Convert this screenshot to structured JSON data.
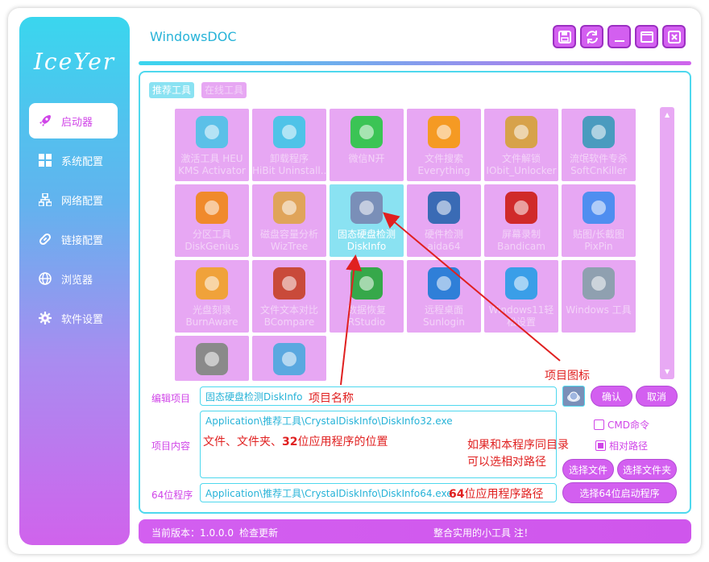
{
  "sidebar": {
    "logo": "IceYer",
    "items": [
      {
        "label": "启动器",
        "icon": "rocket-icon"
      },
      {
        "label": "系统配置",
        "icon": "windows-icon"
      },
      {
        "label": "网络配置",
        "icon": "network-icon"
      },
      {
        "label": "链接配置",
        "icon": "link-icon"
      },
      {
        "label": "浏览器",
        "icon": "globe-icon"
      },
      {
        "label": "软件设置",
        "icon": "gear-icon"
      }
    ]
  },
  "header": {
    "title": "WindowsDOC"
  },
  "window_buttons": [
    "save-icon",
    "refresh-icon",
    "minimize-icon",
    "maximize-icon",
    "close-icon"
  ],
  "tabs": [
    "推荐工具",
    "在线工具"
  ],
  "tiles": [
    {
      "line1": "激活工具 HEU",
      "line2": "KMS Activator",
      "icon": "cube-icon",
      "color": "#5bc0e8"
    },
    {
      "line1": "卸载程序",
      "line2": "HiBit Uninstall...",
      "icon": "trash-icon",
      "color": "#4fc3e8"
    },
    {
      "line1": "微信N开",
      "line2": "",
      "icon": "wechat-icon",
      "color": "#3bc455"
    },
    {
      "line1": "文件搜索",
      "line2": "Everything",
      "icon": "magnifier-icon",
      "color": "#f59a23"
    },
    {
      "line1": "文件解锁",
      "line2": "IObit_Unlocker",
      "icon": "padlock-icon",
      "color": "#d7a24a"
    },
    {
      "line1": "流氓软件专杀",
      "line2": "SoftCnKiller",
      "icon": "x-circle-icon",
      "color": "#4a9bbf"
    },
    {
      "line1": "分区工具",
      "line2": "DiskGenius",
      "icon": "diskgenius-icon",
      "color": "#f08a2c"
    },
    {
      "line1": "磁盘容量分析",
      "line2": "WizTree",
      "icon": "wiztree-icon",
      "color": "#e0a45a"
    },
    {
      "line1": "固态硬盘检测",
      "line2": "DiskInfo",
      "icon": "diskinfo-icon",
      "color": "#7a8fb8"
    },
    {
      "line1": "硬件检测",
      "line2": "aida64",
      "icon": "aida64-icon",
      "color": "#3a6bb5"
    },
    {
      "line1": "屏幕录制",
      "line2": "Bandicam",
      "icon": "record-icon",
      "color": "#d02a2a"
    },
    {
      "line1": "贴图/长截图",
      "line2": "PixPin",
      "icon": "pixpin-icon",
      "color": "#4f8ef0"
    },
    {
      "line1": "光盘刻录",
      "line2": "BurnAware",
      "icon": "pencil-icon",
      "color": "#f0a23a"
    },
    {
      "line1": "文件文本对比",
      "line2": "BCompare",
      "icon": "compare-icon",
      "color": "#c94a3a"
    },
    {
      "line1": "数据恢复",
      "line2": "RStudio",
      "icon": "recovery-icon",
      "color": "#36a84a"
    },
    {
      "line1": "远程桌面",
      "line2": "Sunlogin",
      "icon": "sunlogin-icon",
      "color": "#2f7fd8"
    },
    {
      "line1": "Windows11轻",
      "line2": "松设置",
      "icon": "gear-blue-icon",
      "color": "#3a9ee8"
    },
    {
      "line1": "Windows 工具",
      "line2": "",
      "icon": "windows-tools-icon",
      "color": "#8fa0b0"
    },
    {
      "line1": "",
      "line2": "",
      "icon": "printer-icon",
      "color": "#8a8a8a"
    },
    {
      "line1": "",
      "line2": "",
      "icon": "file-arrow-icon",
      "color": "#5aa8e0"
    }
  ],
  "form": {
    "edit_label": "编辑项目",
    "edit_value": "固态硬盘检测DiskInfo",
    "content_label": "项目内容",
    "content_value": "Application\\推荐工具\\CrystalDiskInfo\\DiskInfo32.exe",
    "x64_label": "64位程序",
    "x64_value": "Application\\推荐工具\\CrystalDiskInfo\\DiskInfo64.exe",
    "confirm": "确认",
    "cancel": "取消",
    "cmd_label": "CMD命令",
    "relative_label": "相对路径",
    "select_file": "选择文件",
    "select_folder": "选择文件夹",
    "select_64": "选择64位启动程序"
  },
  "annotations": {
    "icon_note": "项目图标",
    "name_note": "项目名称",
    "path_note_1": "文件、文件夹、",
    "path_note_2": "32",
    "path_note_3": "位应用程序的位置",
    "rel_note_1": "如果和本程序同目录",
    "rel_note_2": "可以选相对路径",
    "x64_note_1": "64",
    "x64_note_2": "位应用程序路径"
  },
  "status": {
    "version": "当前版本：1.0.0.0",
    "check_update": "检查更新",
    "slogan": "整合实用的小工具 注！"
  }
}
